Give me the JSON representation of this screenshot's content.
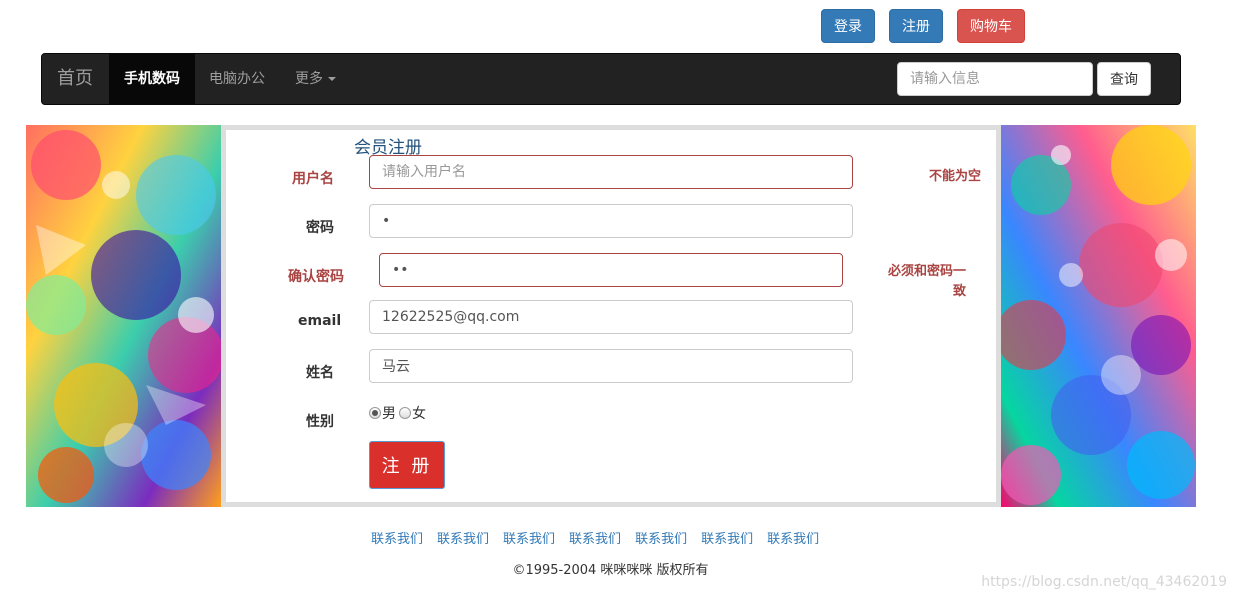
{
  "top_buttons": {
    "login": "登录",
    "register": "注册",
    "cart": "购物车"
  },
  "navbar": {
    "brand": "首页",
    "items": [
      {
        "label": "手机数码",
        "active": true
      },
      {
        "label": "电脑办公",
        "active": false
      },
      {
        "label": "更多",
        "active": false
      }
    ],
    "search_placeholder": "请输入信息",
    "search_button": "查询"
  },
  "form": {
    "title": "会员注册",
    "username": {
      "label": "用户名",
      "placeholder": "请输入用户名",
      "hint": "不能为空"
    },
    "password": {
      "label": "密码",
      "value": "•"
    },
    "confirm": {
      "label": "确认密码",
      "value": "••",
      "hint": "必须和密码一致"
    },
    "email": {
      "label": "email",
      "value": "12622525@qq.com"
    },
    "name": {
      "label": "姓名",
      "value": "马云"
    },
    "gender": {
      "label": "性别",
      "options": [
        "男",
        "女"
      ],
      "selected": "男"
    },
    "submit": "注 册"
  },
  "footer": {
    "links": [
      "联系我们",
      "联系我们",
      "联系我们",
      "联系我们",
      "联系我们",
      "联系我们",
      "联系我们"
    ],
    "copyright": "©1995-2004 咪咪咪咪 版权所有"
  },
  "watermark": "https://blog.csdn.net/qq_43462019",
  "colors": {
    "primary": "#337ab7",
    "danger": "#d9534f",
    "navbar_bg": "#222222",
    "error": "#a94442"
  }
}
